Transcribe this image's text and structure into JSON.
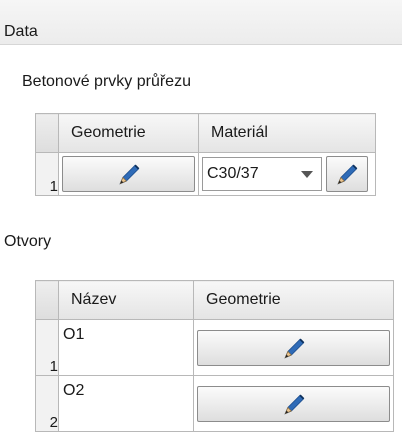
{
  "panel": {
    "title": "Data"
  },
  "concrete": {
    "label": "Betonové prvky průřezu",
    "headers": [
      "Geometrie",
      "Materiál"
    ],
    "rows": [
      {
        "num": "1",
        "material": "C30/37"
      }
    ]
  },
  "openings": {
    "label": "Otvory",
    "headers": [
      "Název",
      "Geometrie"
    ],
    "rows": [
      {
        "num": "1",
        "name": "O1"
      },
      {
        "num": "2",
        "name": "O2"
      }
    ]
  },
  "icons": {
    "edit": "pencil-icon",
    "dropdown": "chevron-down-icon"
  }
}
